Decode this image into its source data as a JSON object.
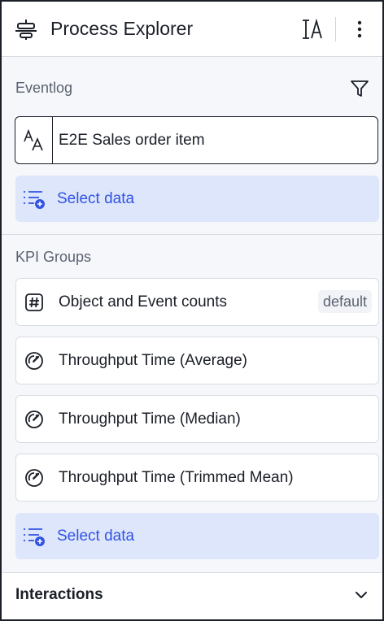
{
  "header": {
    "title": "Process Explorer",
    "icons": [
      "process-explorer-icon",
      "text-format-icon",
      "more-vertical-icon"
    ]
  },
  "eventlog": {
    "section_label": "Eventlog",
    "field_value": "E2E Sales order item",
    "select_data_label": "Select data",
    "icons": [
      "filter-icon",
      "text-type-icon",
      "select-data-list-icon"
    ]
  },
  "kpi_groups": {
    "section_label": "KPI Groups",
    "items": [
      {
        "label": "Object and Event counts",
        "badge": "default",
        "icon": "hash-icon"
      },
      {
        "label": "Throughput Time (Average)",
        "icon": "gauge-icon"
      },
      {
        "label": "Throughput Time (Median)",
        "icon": "gauge-icon"
      },
      {
        "label": "Throughput Time (Trimmed Mean)",
        "icon": "gauge-icon"
      }
    ],
    "select_data_label": "Select data"
  },
  "interactions": {
    "label": "Interactions",
    "icon": "chevron-down-icon"
  },
  "colors": {
    "accent": "#3253e4",
    "accent_bg": "#dde6fb",
    "panel_bg": "#f5f7fb",
    "border": "#1b1f27"
  }
}
